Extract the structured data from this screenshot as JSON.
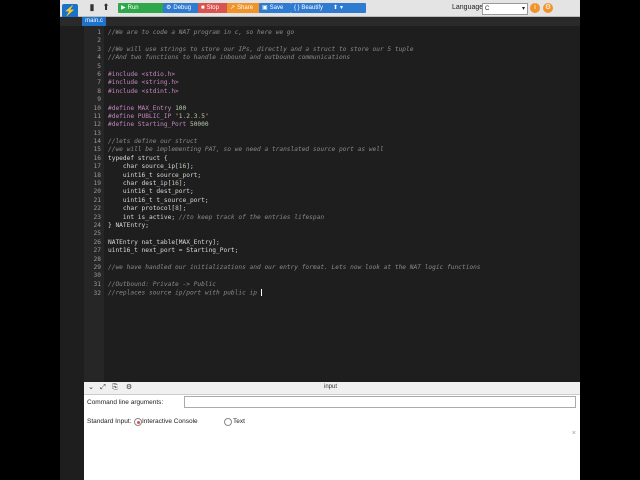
{
  "toolbar": {
    "run_label": "Run",
    "debug_label": "Debug",
    "stop_label": "Stop",
    "share_label": "Share",
    "save_label": "Save",
    "beautify_label": "{ } Beautify",
    "language_label": "Language",
    "language_value": "C"
  },
  "tabs": [
    {
      "label": "main.c"
    }
  ],
  "editor": {
    "lines": [
      "//We are to code a NAT program in c, so here we go",
      "",
      "//We will use strings to store our IPs, directly and a struct to store our 5 tuple",
      "//And two functions to handle inbound and outbound communications",
      "",
      "#include <stdio.h>",
      "#include <string.h>",
      "#include <stdint.h>",
      "",
      "#define MAX_Entry 100",
      "#define PUBLIC_IP \"1.2.3.5\"",
      "#define Starting_Port 50000",
      "",
      "//lets define our struct",
      "//we will be implementing PAT, so we need a translated source port as well",
      "typedef struct {",
      "    char source_ip[16];",
      "    uint16_t source_port;",
      "    char dest_ip[16];",
      "    uint16_t dest_port;",
      "    uint16_t t_source_port;",
      "    char protocol[8];",
      "    int is_active; //to keep track of the entries lifespan",
      "} NATEntry;",
      "",
      "NATEntry nat_table[MAX_Entry];",
      "uint16_t next_port = Starting_Port;",
      "",
      "//we have handled our initializations and our entry format. Lets now look at the NAT logic functions",
      "",
      "//Outbound: Private -> Public",
      "//replaces source ip/port with public ip "
    ]
  },
  "bottom_panel": {
    "title": "input",
    "cla_label": "Command line arguments:",
    "stdin_label": "Standard Input:",
    "options": [
      "Interactive Console",
      "Text"
    ],
    "selected": "Interactive Console"
  },
  "colors": {
    "run": "#2ea84a",
    "debug": "#2f7bd1",
    "stop": "#d9534f",
    "share": "#f0932b",
    "accent": "#1e73c8"
  }
}
